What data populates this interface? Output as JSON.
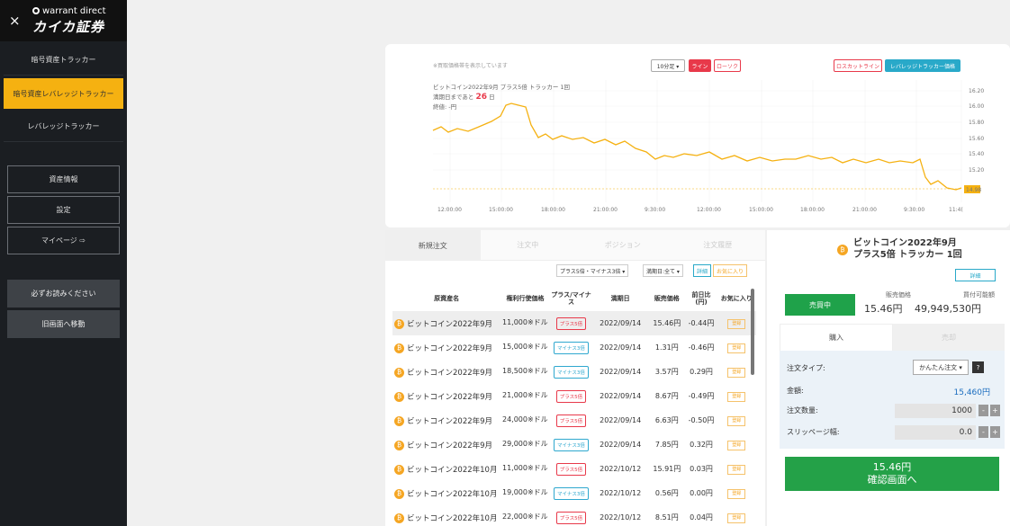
{
  "sidebar": {
    "close": "×",
    "logo_top": "warrant direct",
    "logo_main": "カイカ証券",
    "nav": [
      "暗号資産トラッカー",
      "暗号資産レバレッジトラッカー",
      "レバレッジトラッカー"
    ],
    "boxes": [
      "資産情報",
      "設定",
      "マイページ ⇨"
    ],
    "links": [
      "必ずお読みください",
      "旧画面へ移動"
    ]
  },
  "chart": {
    "note": "※買取価格帯を表示しています",
    "interval": "10分足 ▾",
    "btn_line": "ライン",
    "btn_candle": "ローソク",
    "btn_losscut": "ロスカットライン",
    "btn_tracker_price": "レバレッジトラッカー価格",
    "legend_name": "ビットコイン2022年9月 プラス5倍 トラッカー 1回",
    "legend_days_prefix": "満期日まであと",
    "legend_days": "26",
    "legend_days_suffix": "日",
    "legend_close": "終値: -円",
    "current_price": "14.98",
    "y_ticks": [
      "16.20",
      "16.00",
      "15.80",
      "15.60",
      "15.40",
      "15.20"
    ],
    "x_ticks": [
      "12:00:00",
      "15:00:00",
      "18:00:00",
      "21:00:00",
      "9:30:00",
      "12:00:00",
      "15:00:00",
      "18:00:00",
      "21:00:00",
      "9:30:00",
      "11:4("
    ]
  },
  "order": {
    "tabs": [
      "新規注文",
      "注文中",
      "ポジション",
      "注文履歴"
    ],
    "filter_type": "プラス5倍・マイナス3倍 ▾",
    "filter_expiry": "満期日:全て ▾",
    "btn_detail": "詳細",
    "btn_fav": "お気に入り",
    "headers": {
      "name": "原資産名",
      "strike": "権利行使価格",
      "pm": "プラス/マイナス",
      "expiry": "満期日",
      "price": "販売価格",
      "change": "前日比 (円)",
      "fav": "お気に入り"
    },
    "rows": [
      {
        "name": "ビットコイン2022年9月",
        "strike": "11,000※ドル",
        "pm": "プラス5倍",
        "expiry": "2022/09/14",
        "price": "15.46円",
        "change": "-0.44円",
        "fav": "登録"
      },
      {
        "name": "ビットコイン2022年9月",
        "strike": "15,000※ドル",
        "pm": "マイナス3倍",
        "expiry": "2022/09/14",
        "price": "1.31円",
        "change": "-0.46円",
        "fav": "登録"
      },
      {
        "name": "ビットコイン2022年9月",
        "strike": "18,500※ドル",
        "pm": "マイナス3倍",
        "expiry": "2022/09/14",
        "price": "3.57円",
        "change": "0.29円",
        "fav": "登録"
      },
      {
        "name": "ビットコイン2022年9月",
        "strike": "21,000※ドル",
        "pm": "プラス5倍",
        "expiry": "2022/09/14",
        "price": "8.67円",
        "change": "-0.49円",
        "fav": "登録"
      },
      {
        "name": "ビットコイン2022年9月",
        "strike": "24,000※ドル",
        "pm": "プラス5倍",
        "expiry": "2022/09/14",
        "price": "6.63円",
        "change": "-0.50円",
        "fav": "登録"
      },
      {
        "name": "ビットコイン2022年9月",
        "strike": "29,000※ドル",
        "pm": "マイナス3倍",
        "expiry": "2022/09/14",
        "price": "7.85円",
        "change": "0.32円",
        "fav": "登録"
      },
      {
        "name": "ビットコイン2022年10月",
        "strike": "11,000※ドル",
        "pm": "プラス5倍",
        "expiry": "2022/10/12",
        "price": "15.91円",
        "change": "0.03円",
        "fav": "登録"
      },
      {
        "name": "ビットコイン2022年10月",
        "strike": "19,000※ドル",
        "pm": "マイナス3倍",
        "expiry": "2022/10/12",
        "price": "0.56円",
        "change": "0.00円",
        "fav": "登録"
      },
      {
        "name": "ビットコイン2022年10月",
        "strike": "22,000※ドル",
        "pm": "プラス5倍",
        "expiry": "2022/10/12",
        "price": "8.51円",
        "change": "0.04円",
        "fav": "登録"
      }
    ]
  },
  "panel": {
    "title_line1": "ビットコイン2022年9月",
    "title_line2": "プラス5倍 トラッカー 1回",
    "btn_detail": "詳細",
    "status": "売買中",
    "sell_label": "販売価格",
    "sell_value": "15.46円",
    "buy_power_label": "買付可能額",
    "buy_power_value": "49,949,530円",
    "tab_buy": "購入",
    "tab_sell": "売却",
    "order_type_label": "注文タイプ:",
    "order_type_value": "かんたん注文 ▾",
    "help": "?",
    "amount_label": "金額:",
    "amount_value": "15,460円",
    "qty_label": "注文数量:",
    "qty_value": "1000",
    "slip_label": "スリッページ幅:",
    "slip_value": "0.0",
    "minus": "-",
    "plus": "+",
    "confirm_price": "15.46円",
    "confirm_label": "確認画面へ"
  },
  "colors": {
    "accent_yellow": "#f5b111",
    "line_red": "#e8394a",
    "teal": "#29a9c9",
    "green": "#24a148",
    "chart_line": "#f5b111"
  }
}
